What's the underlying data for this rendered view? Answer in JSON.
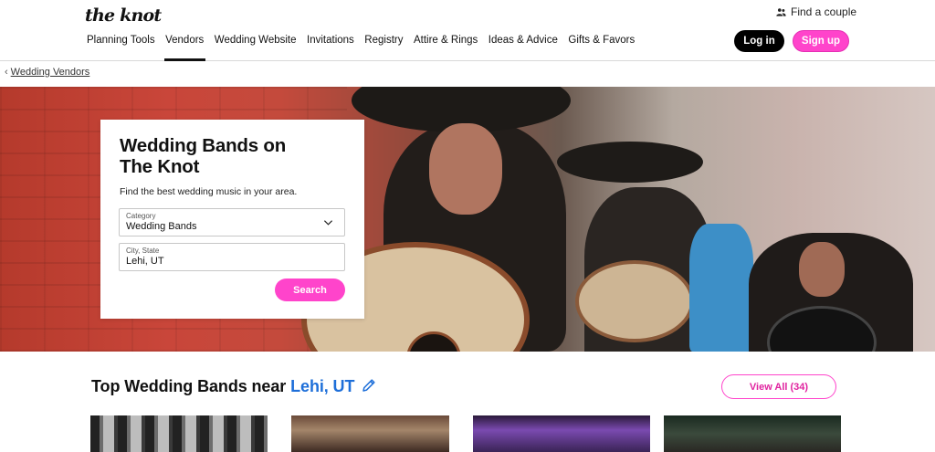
{
  "header": {
    "logo": "the knot",
    "find_couple": "Find a couple",
    "nav": [
      {
        "label": "Planning Tools",
        "active": false
      },
      {
        "label": "Vendors",
        "active": true
      },
      {
        "label": "Wedding Website",
        "active": false
      },
      {
        "label": "Invitations",
        "active": false
      },
      {
        "label": "Registry",
        "active": false
      },
      {
        "label": "Attire & Rings",
        "active": false
      },
      {
        "label": "Ideas & Advice",
        "active": false
      },
      {
        "label": "Gifts & Favors",
        "active": false
      }
    ],
    "login_label": "Log in",
    "signup_label": "Sign up"
  },
  "breadcrumb": {
    "label": "Wedding Vendors"
  },
  "search_card": {
    "title": "Wedding Bands on The Knot",
    "subtitle": "Find the best wedding music in your area.",
    "category_label": "Category",
    "category_value": "Wedding Bands",
    "location_label": "City, State",
    "location_value": "Lehi, UT",
    "search_label": "Search"
  },
  "section": {
    "title_prefix": "Top Wedding Bands near",
    "location": "Lehi, UT",
    "view_all_label": "View All (34)"
  },
  "colors": {
    "accent_pink": "#ff44cb",
    "location_blue": "#1e6fd9",
    "black": "#000000"
  }
}
